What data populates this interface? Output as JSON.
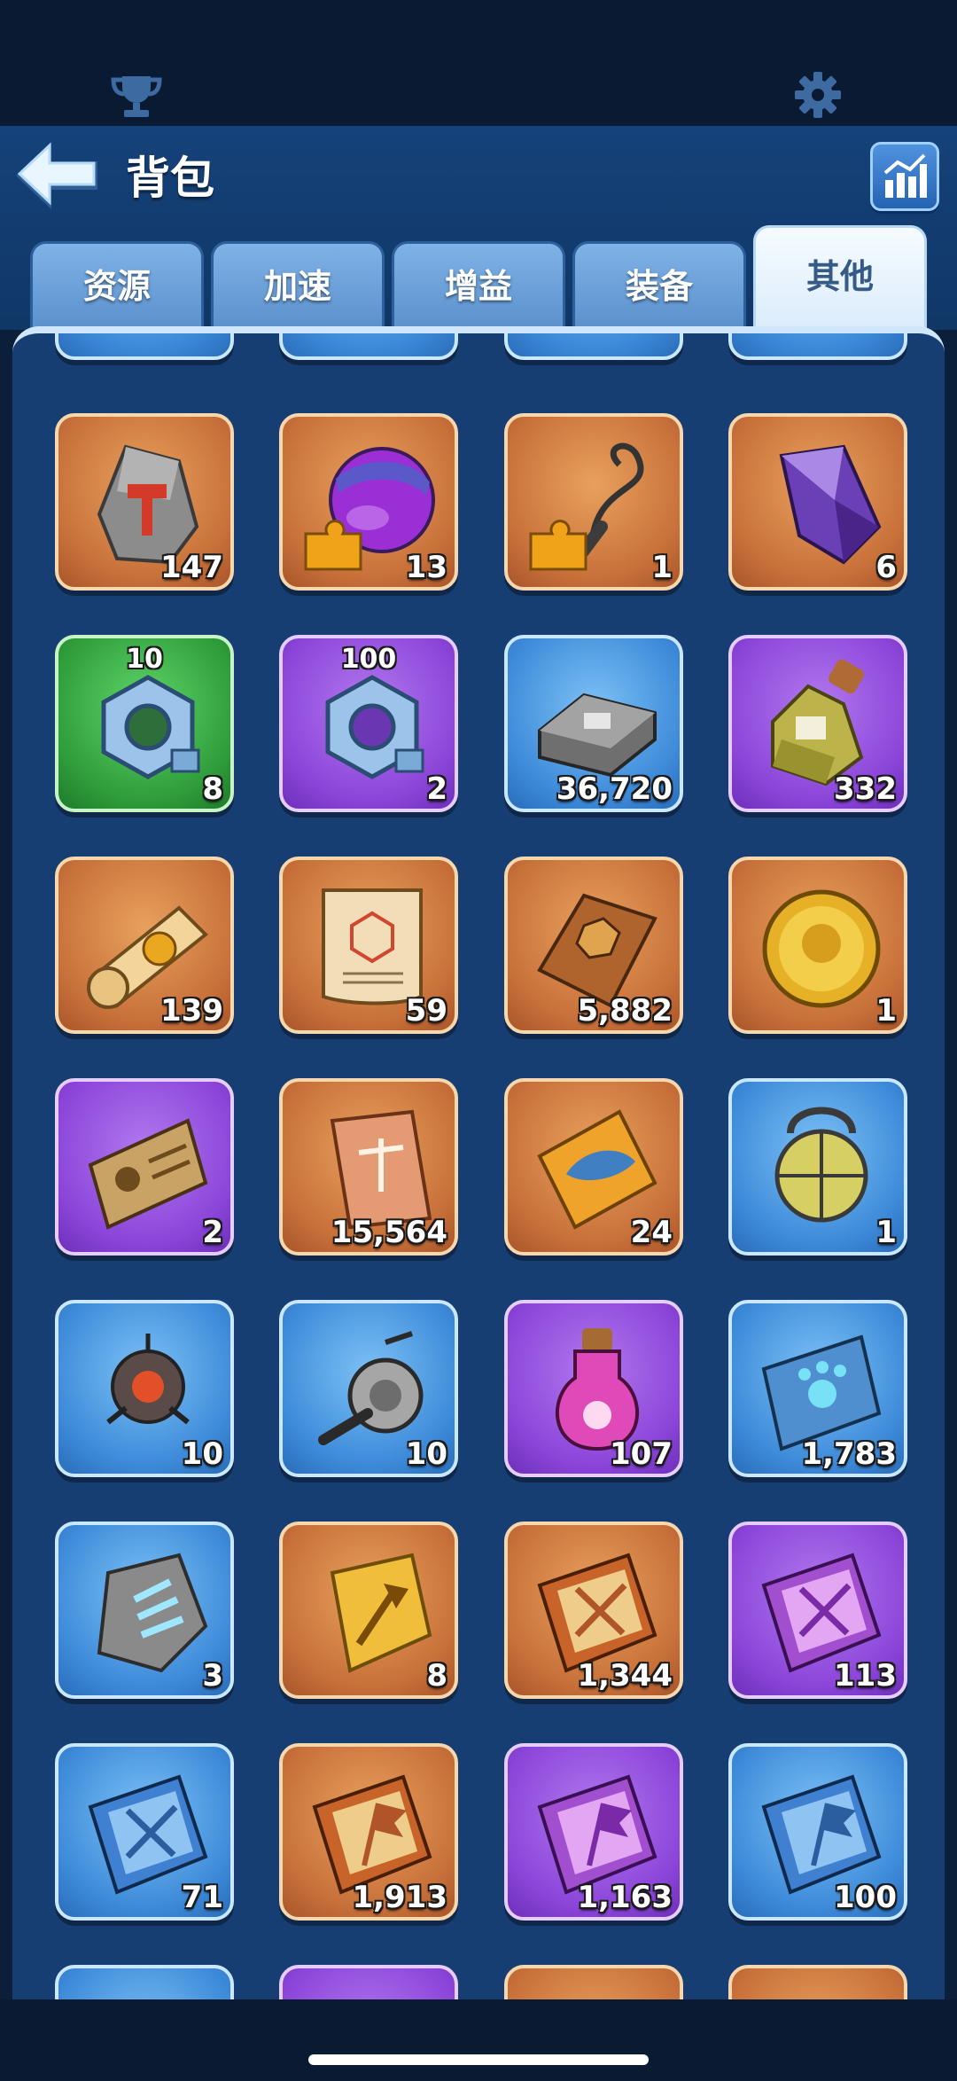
{
  "header": {
    "title": "背包",
    "back_icon": "back-arrow-icon",
    "stats_icon": "bar-chart-icon"
  },
  "topbar": {
    "trophy_icon": "trophy-icon",
    "settings_icon": "gear-icon"
  },
  "tabs": [
    {
      "label": "资源",
      "active": false
    },
    {
      "label": "加速",
      "active": false
    },
    {
      "label": "增益",
      "active": false
    },
    {
      "label": "装备",
      "active": false
    },
    {
      "label": "其他",
      "active": true
    }
  ],
  "items": [
    {
      "count": "147",
      "rarity": "orange",
      "icon": "stone-with-hammer-icon"
    },
    {
      "count": "13",
      "rarity": "orange",
      "icon": "purple-orb-fragment-icon"
    },
    {
      "count": "1",
      "rarity": "orange",
      "icon": "whip-fragment-icon"
    },
    {
      "count": "6",
      "rarity": "orange",
      "icon": "purple-crystal-icon"
    },
    {
      "count": "8",
      "rarity": "green",
      "icon": "hex-nut-icon",
      "tier": "10"
    },
    {
      "count": "2",
      "rarity": "purple",
      "icon": "hex-nut-icon",
      "tier": "100"
    },
    {
      "count": "36,720",
      "rarity": "blue",
      "icon": "iron-ingot-icon"
    },
    {
      "count": "332",
      "rarity": "purple",
      "icon": "potion-bottle-icon"
    },
    {
      "count": "139",
      "rarity": "orange",
      "icon": "scroll-with-seal-icon"
    },
    {
      "count": "59",
      "rarity": "orange",
      "icon": "parchment-scroll-icon"
    },
    {
      "count": "5,882",
      "rarity": "orange",
      "icon": "brown-book-icon"
    },
    {
      "count": "1",
      "rarity": "orange",
      "icon": "gold-coin-icon"
    },
    {
      "count": "2",
      "rarity": "purple",
      "icon": "id-tag-icon"
    },
    {
      "count": "15,564",
      "rarity": "orange",
      "icon": "scales-ticket-icon"
    },
    {
      "count": "24",
      "rarity": "orange",
      "icon": "fish-ticket-icon"
    },
    {
      "count": "1",
      "rarity": "blue",
      "icon": "caged-lantern-icon"
    },
    {
      "count": "10",
      "rarity": "blue",
      "icon": "drone-robot-icon"
    },
    {
      "count": "10",
      "rarity": "blue",
      "icon": "fishing-reel-icon"
    },
    {
      "count": "107",
      "rarity": "purple",
      "icon": "paw-potion-icon"
    },
    {
      "count": "1,783",
      "rarity": "blue",
      "icon": "paw-book-icon"
    },
    {
      "count": "3",
      "rarity": "blue",
      "icon": "claw-stone-icon"
    },
    {
      "count": "8",
      "rarity": "orange",
      "icon": "gold-axe-ticket-icon"
    },
    {
      "count": "1,344",
      "rarity": "orange",
      "icon": "sword-book-icon"
    },
    {
      "count": "113",
      "rarity": "purple",
      "icon": "sword-book-icon"
    },
    {
      "count": "71",
      "rarity": "blue",
      "icon": "sword-notebook-icon"
    },
    {
      "count": "1,913",
      "rarity": "orange",
      "icon": "flag-book-icon"
    },
    {
      "count": "1,163",
      "rarity": "purple",
      "icon": "flag-book-icon"
    },
    {
      "count": "100",
      "rarity": "blue",
      "icon": "flag-notebook-icon"
    }
  ]
}
